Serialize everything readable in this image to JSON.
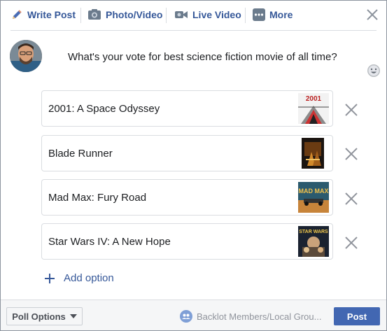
{
  "tabs": [
    {
      "label": "Write Post",
      "icon": "pencil-icon"
    },
    {
      "label": "Photo/Video",
      "icon": "camera-icon"
    },
    {
      "label": "Live Video",
      "icon": "video-camera-icon"
    },
    {
      "label": "More",
      "icon": "more-icon"
    }
  ],
  "composer": {
    "question": "What's your vote for best science fiction movie of all time?"
  },
  "options": [
    {
      "text": "2001: A Space Odyssey",
      "thumb_title": "2001"
    },
    {
      "text": "Blade Runner"
    },
    {
      "text": "Mad Max: Fury Road",
      "thumb_title": "MAD MAX"
    },
    {
      "text": "Star Wars IV: A New Hope",
      "thumb_title": "STAR WARS"
    }
  ],
  "add_option_label": "Add option",
  "footer": {
    "poll_options_label": "Poll Options",
    "audience_label": "Backlot Members/Local Grou...",
    "post_label": "Post"
  },
  "colors": {
    "link": "#365899",
    "post_button": "#4267b2",
    "border": "#dadde1"
  }
}
